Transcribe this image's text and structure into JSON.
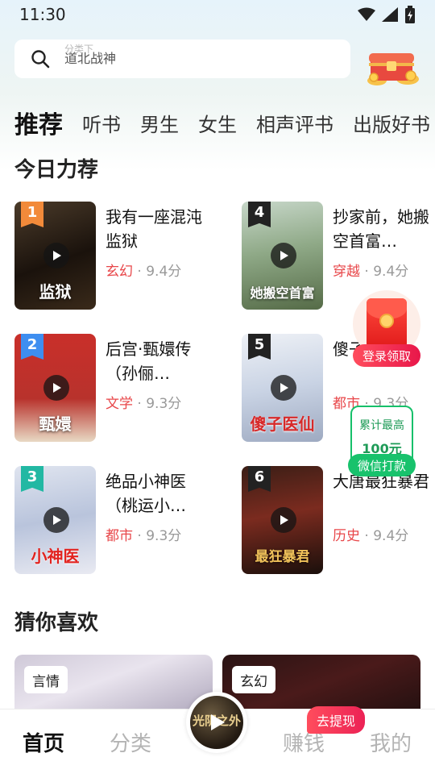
{
  "status_bar": {
    "time": "11:30"
  },
  "search": {
    "ghost_hint": "分类下",
    "current_term": "道北战神"
  },
  "tabs": [
    {
      "label": "推荐",
      "active": true
    },
    {
      "label": "听书"
    },
    {
      "label": "男生"
    },
    {
      "label": "女生"
    },
    {
      "label": "相声评书"
    },
    {
      "label": "出版好书"
    }
  ],
  "today_section": {
    "title": "今日力荐"
  },
  "books": [
    {
      "rank": "1",
      "title": "我有一座混沌监狱",
      "genre": "玄幻",
      "score": "9.4分",
      "cover_text": "监狱",
      "badge_color": "#f28a3a"
    },
    {
      "rank": "4",
      "title": "抄家前，她搬空首富…",
      "genre": "穿越",
      "score": "9.4分",
      "cover_text": "她搬空首富",
      "badge_color": "#222222"
    },
    {
      "rank": "2",
      "title": "后宫·甄嬛传（孙俪…",
      "genre": "文学",
      "score": "9.3分",
      "cover_text": "甄嬛",
      "badge_color": "#3e8ef0"
    },
    {
      "rank": "5",
      "title": "傻子医仙",
      "genre": "都市",
      "score": "9.3分",
      "cover_text": "傻子医仙",
      "badge_color": "#222222"
    },
    {
      "rank": "3",
      "title": "绝品小神医（桃运小…",
      "genre": "都市",
      "score": "9.3分",
      "cover_text": "小神医",
      "badge_color": "#22b8a3"
    },
    {
      "rank": "6",
      "title": "大唐最狂暴君",
      "genre": "历史",
      "score": "9.4分",
      "cover_text": "最狂暴君",
      "badge_color": "#222222"
    }
  ],
  "floating_packet": {
    "label": "登录领取"
  },
  "floating_cash": {
    "top": "累计最高",
    "amount": "100元",
    "button": "微信打款"
  },
  "guess_section": {
    "title": "猜你喜欢"
  },
  "guess_cards": [
    {
      "tag": "言情"
    },
    {
      "tag": "玄幻"
    }
  ],
  "bottom_nav": {
    "home": "首页",
    "category": "分类",
    "earn": "赚钱",
    "mine": "我的",
    "withdraw_badge": "去提现",
    "center_disc_text": "光阴之外"
  },
  "colors": {
    "accent_red": "#e8474a",
    "green": "#18c26c"
  }
}
